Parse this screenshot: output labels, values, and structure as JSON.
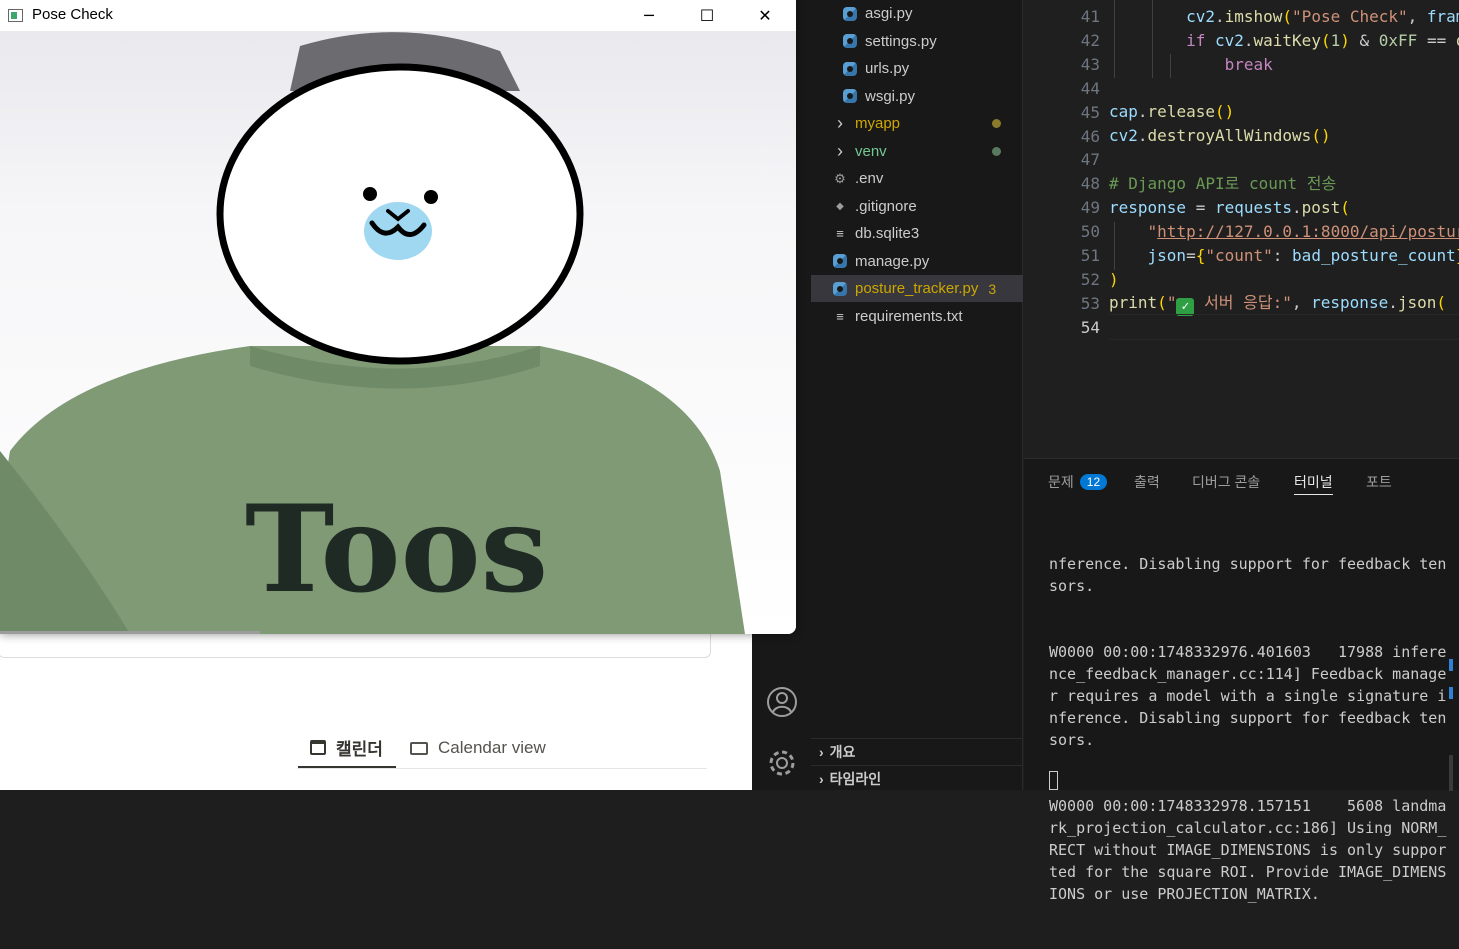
{
  "pose_window": {
    "title": "Pose Check",
    "minimize_icon": "minimize-icon",
    "maximize_icon": "maximize-icon",
    "close_icon": "close-icon",
    "sweater_text": "Toos"
  },
  "background_app": {
    "tabs": [
      {
        "label": "캘린더",
        "icon": "calendar-icon"
      },
      {
        "label": "Calendar view",
        "icon": "calendar-view-icon"
      }
    ]
  },
  "activity_bar": {
    "account_icon": "account-icon",
    "settings_icon": "gear-icon"
  },
  "explorer": {
    "items": [
      {
        "name": "asgi.py",
        "type": "python",
        "indent": 2
      },
      {
        "name": "settings.py",
        "type": "python",
        "indent": 2
      },
      {
        "name": "urls.py",
        "type": "python",
        "indent": 2
      },
      {
        "name": "wsgi.py",
        "type": "python",
        "indent": 2
      },
      {
        "name": "myapp",
        "type": "folder",
        "indent": 1,
        "color": "#cca700",
        "dot": "#8a7a2a"
      },
      {
        "name": "venv",
        "type": "folder",
        "indent": 1,
        "color": "#73c991",
        "dot": "#5a7a60"
      },
      {
        "name": ".env",
        "type": "gear",
        "indent": 1
      },
      {
        "name": ".gitignore",
        "type": "git",
        "indent": 1
      },
      {
        "name": "db.sqlite3",
        "type": "text",
        "indent": 1
      },
      {
        "name": "manage.py",
        "type": "python",
        "indent": 1
      },
      {
        "name": "posture_tracker.py",
        "type": "python",
        "indent": 1,
        "color": "#cca700",
        "badge": "3",
        "selected": true
      },
      {
        "name": "requirements.txt",
        "type": "text",
        "indent": 1
      }
    ],
    "sections": [
      "개요",
      "타임라인"
    ]
  },
  "editor": {
    "line_numbers": [
      "41",
      "42",
      "43",
      "44",
      "45",
      "46",
      "47",
      "48",
      "49",
      "50",
      "51",
      "52",
      "53",
      "54"
    ],
    "active_line": "54"
  },
  "panel": {
    "tabs": [
      "문제",
      "출력",
      "디버그 콘솔",
      "터미널",
      "포트"
    ],
    "problems_count": "12",
    "active_tab": "터미널",
    "terminal_lines": [
      "nference. Disabling support for feedback tensors.",
      "W0000 00:00:1748332976.401603   17988 inference_feedback_manager.cc:114] Feedback manager requires a model with a single signature inference. Disabling support for feedback tensors.",
      "W0000 00:00:1748332978.157151    5608 landmark_projection_calculator.cc:186] Using NORM_RECT without IMAGE_DIMENSIONS is only supported for the square ROI. Provide IMAGE_DIMENSIONS or use PROJECTION_MATRIX."
    ]
  }
}
